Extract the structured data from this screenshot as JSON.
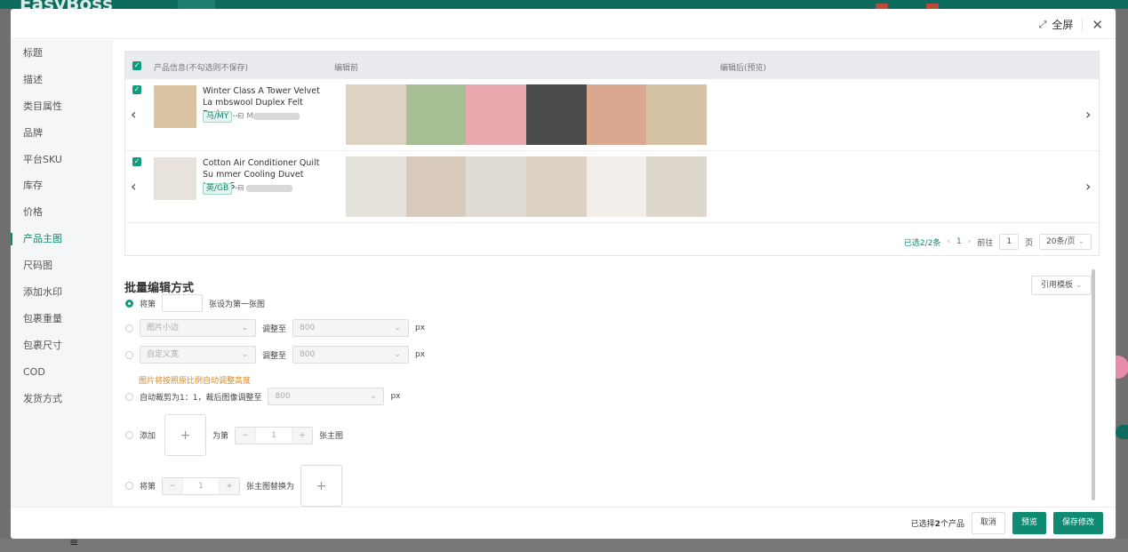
{
  "background": {
    "logo": "EasyBoss",
    "menu_glyph": "≡",
    "badge_text": "EasyBoss"
  },
  "header": {
    "fullscreen_label": "全屏",
    "fullscreen_icon": "expand-icon",
    "close_glyph": "✕"
  },
  "sidebar": {
    "items": [
      {
        "label": "标题"
      },
      {
        "label": "描述"
      },
      {
        "label": "类目属性"
      },
      {
        "label": "品牌"
      },
      {
        "label": "平台SKU"
      },
      {
        "label": "库存"
      },
      {
        "label": "价格"
      },
      {
        "label": "产品主图"
      },
      {
        "label": "尺码图"
      },
      {
        "label": "添加水印"
      },
      {
        "label": "包裹重量"
      },
      {
        "label": "包裹尺寸"
      },
      {
        "label": "COD"
      },
      {
        "label": "发货方式"
      }
    ],
    "active": "产品主图"
  },
  "table": {
    "columns": [
      "产品信息(不勾选则不保存)",
      "编辑前",
      "编辑后(预览)"
    ],
    "rows": [
      {
        "title": "Winter Class A Tower Velvet La mbswool Duplex Felt Bedroo...",
        "tag": "马/MY",
        "shop_prefix": "M",
        "thumb_color": "#d9c3a3",
        "images": [
          "#ded3c3",
          "#a7bd93",
          "#e7a7ac",
          "#4a4a4c",
          "#d9a88e",
          "#d6c2a5"
        ]
      },
      {
        "title": "Cotton Air Conditioner Quilt Su mmer Cooling Duvet Insert S...",
        "tag": "英/GB",
        "shop_prefix": "",
        "thumb_color": "#e7e3dc",
        "images": [
          "#e5e2dc",
          "#d8cbbb",
          "#e0dbd3",
          "#dcd1c3",
          "#f2efea",
          "#ded7cb"
        ]
      }
    ]
  },
  "pager": {
    "selected": "已选2/2条",
    "page": "1",
    "goto_label": "前往",
    "goto_value": "1",
    "page_unit": "页",
    "page_size": "20条/页"
  },
  "batch": {
    "title": "批量编辑方式",
    "template_button": "引用模板",
    "opt1_prefix": "将第",
    "opt1_suffix": "张设为第一张图",
    "opt2_select": "图片小边",
    "opt2_adjust": "调整至",
    "opt2_value": "800",
    "unit_px": "px",
    "opt3_select": "自定义宽",
    "opt3_adjust": "调整至",
    "opt3_value": "800",
    "note": "图片将按照原比例自动调整高度",
    "opt4_label": "自动裁剪为1：1，裁后图像调整至",
    "opt4_value": "800",
    "opt5_prefix": "添加",
    "opt5_middle": "为第",
    "opt5_value": "1",
    "opt5_suffix": "张主图",
    "opt6_prefix": "将第",
    "opt6_value": "1",
    "opt6_suffix": "张主图替换为",
    "plus": "+",
    "minus": "−"
  },
  "footer": {
    "selected_prefix": "已选择",
    "selected_count": "2",
    "selected_suffix": "个产品",
    "cancel": "取消",
    "preview": "预览",
    "save": "保存修改"
  },
  "colors": {
    "accent": "#0f8b74",
    "header_bg": "#e9ebee"
  }
}
